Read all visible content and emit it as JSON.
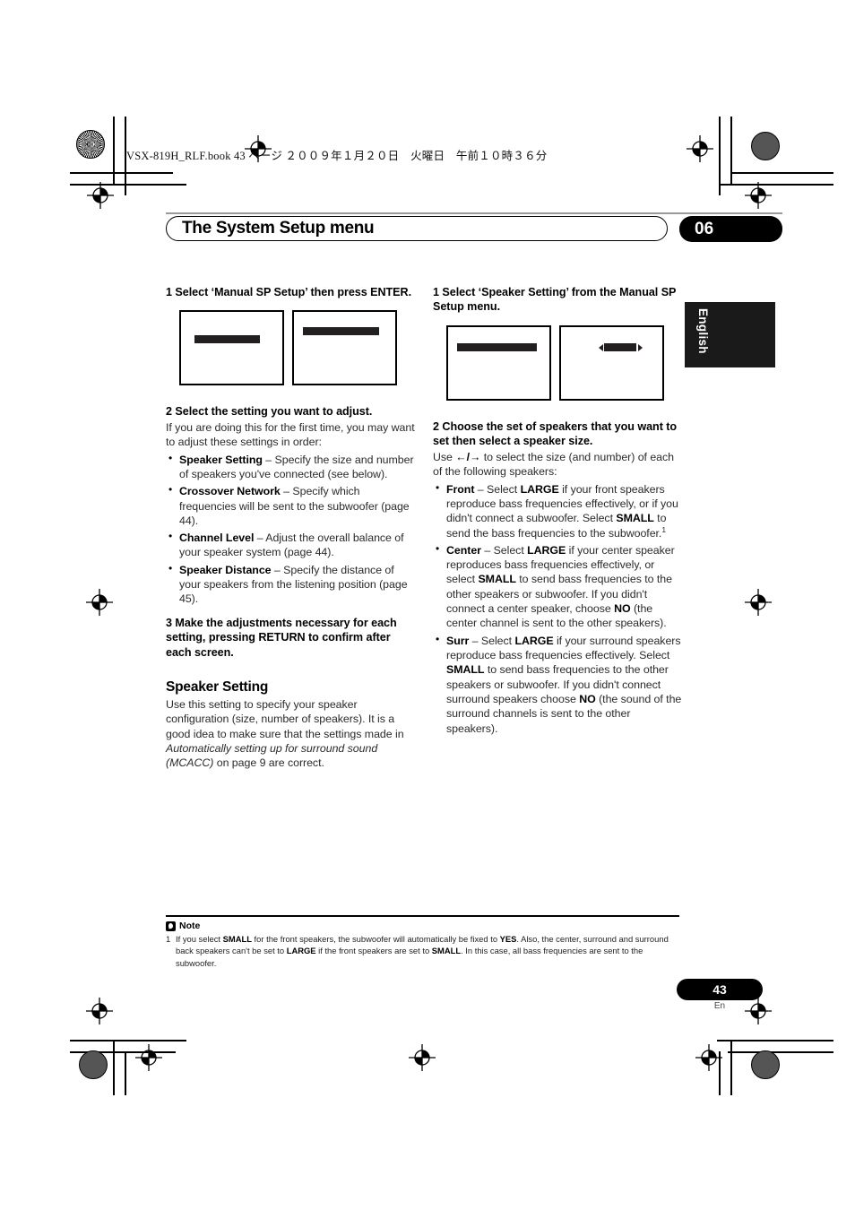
{
  "running_header": "VSX-819H_RLF.book   43 ページ   ２００９年１月２０日　火曜日　午前１０時３６分",
  "header": {
    "chapter_title": "The System Setup menu",
    "chapter_number": "06",
    "language_tab": "English"
  },
  "left_column": {
    "step1": "1    Select ‘Manual SP Setup’ then press ENTER.",
    "step2_title": "2    Select the setting you want to adjust.",
    "step2_body": "If you are doing this for the first time, you may want to adjust these settings in order:",
    "bullets": [
      {
        "term": "Speaker Setting",
        "text": " – Specify the size and number of speakers you've connected (see below)."
      },
      {
        "term": "Crossover Network",
        "text": " – Specify which frequencies will be sent to the subwoofer (page 44)."
      },
      {
        "term": "Channel Level",
        "text": " – Adjust the overall balance of your speaker system (page 44)."
      },
      {
        "term": "Speaker Distance",
        "text": " – Specify the distance of your speakers from the listening position (page 45)."
      }
    ],
    "step3": "3    Make the adjustments necessary for each setting, pressing RETURN to confirm after each screen.",
    "section_title": "Speaker Setting",
    "section_body_1": "Use this setting to specify your speaker configuration (size, number of speakers). It is a good idea to make sure that the settings made in ",
    "section_body_italic": "Automatically setting up for surround sound (MCACC)",
    "section_body_2": " on page 9 are correct."
  },
  "right_column": {
    "step1": "1    Select ‘Speaker Setting’ from the Manual SP Setup menu.",
    "step2_title": "2    Choose the set of speakers that you want to set then select a speaker size.",
    "step2_body_pre": "Use ",
    "step2_arrows": "←/→",
    "step2_body_post": " to select the size (and number) of each of the following speakers:",
    "bullets": [
      {
        "term": "Front",
        "text": " – Select LARGE if your front speakers reproduce bass frequencies effectively, or if you didn't connect a subwoofer. Select SMALL to send the bass frequencies to the subwoofer.1"
      },
      {
        "term": "Center",
        "text": " – Select LARGE if your center speaker reproduces bass frequencies effectively, or select SMALL to send bass frequencies to the other speakers or subwoofer. If you didn't connect a center speaker, choose NO (the center channel is sent to the other speakers)."
      },
      {
        "term": "Surr",
        "text": " – Select LARGE if your surround speakers reproduce bass frequencies effectively. Select SMALL to send bass frequencies to the other speakers or subwoofer. If you didn't connect surround speakers choose NO (the sound of the surround channels is sent to the other speakers)."
      }
    ]
  },
  "note": {
    "label": "Note",
    "marker": "1",
    "text": "If you select SMALL for the front speakers, the subwoofer will automatically be fixed to YES. Also, the center, surround and surround back speakers can't be set to LARGE if the front speakers are set to SMALL. In this case, all bass frequencies are sent to the subwoofer."
  },
  "footer": {
    "page_number": "43",
    "page_language": "En"
  }
}
